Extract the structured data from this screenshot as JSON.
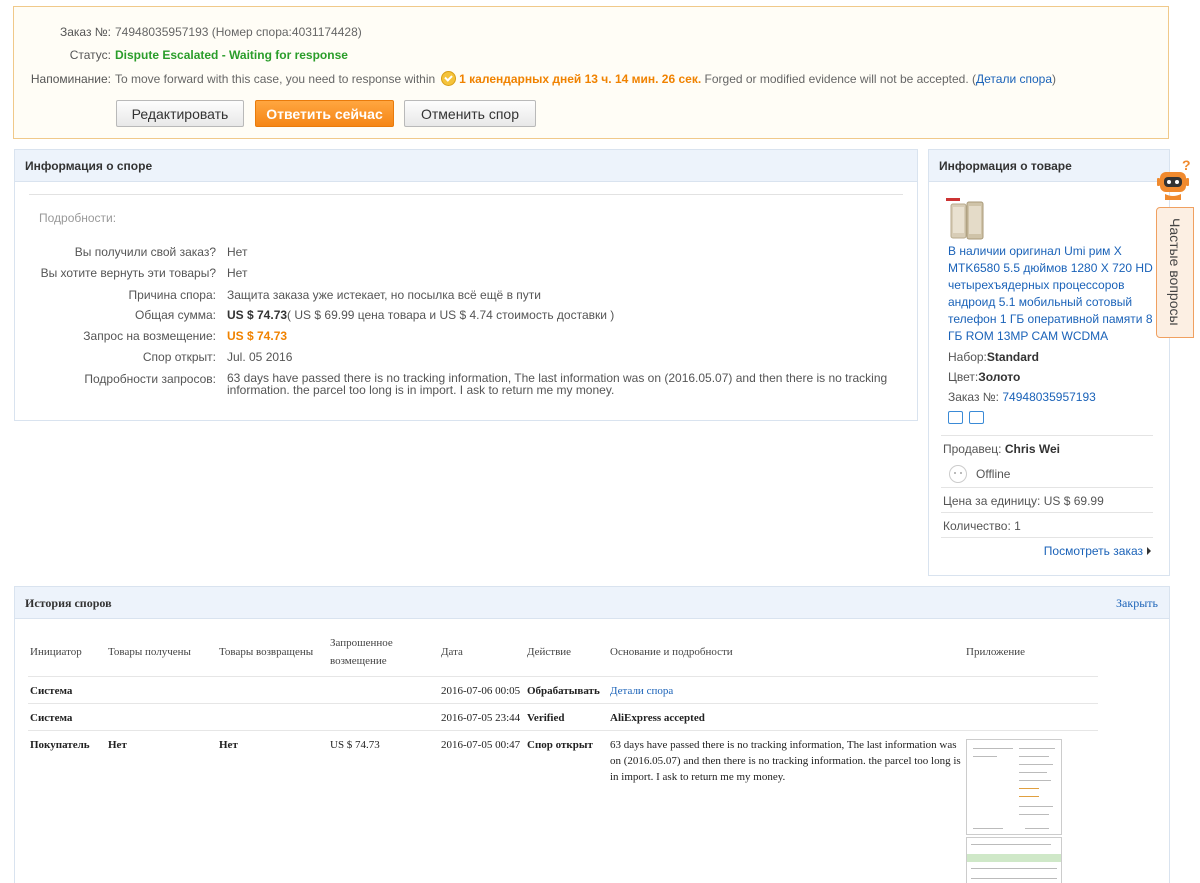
{
  "order": {
    "number_label": "Заказ №:",
    "number_value": "74948035957193 (Номер спора:4031174428)",
    "status_label": "Статус:",
    "status_value": "Dispute Escalated - Waiting for response",
    "reminder_label": "Напоминание:",
    "reminder_text": "To move forward with this case, you need to response within",
    "countdown": "1 календарных дней 13 ч. 14 мин. 26 сек.",
    "reminder_suffix": "Forged or modified evidence will not be accepted.",
    "paren_open": "(",
    "details_link": "Детали спора",
    "paren_close": ")",
    "buttons": {
      "edit": "Редактировать",
      "respond": "Ответить сейчас",
      "cancel": "Отменить спор"
    },
    "colors": {
      "status": "#2a9d2a",
      "countdown": "#f08200",
      "respond_button": "#f58616"
    }
  },
  "dispute": {
    "title": "Информация о споре",
    "details_title": "Подробности:",
    "rows": [
      {
        "label": "Вы получили свой заказ?",
        "value": "Нет"
      },
      {
        "label": "Вы хотите вернуть эти товары?",
        "value": "Нет"
      },
      {
        "label": "Причина спора:",
        "value": "Защита заказа уже истекает, но посылка всё ещё в пути"
      },
      {
        "label": "Общая сумма:",
        "value": "US $ 74.73",
        "extra": "( US $ 69.99 цена товара и US $ 4.74 стоимость доставки )"
      },
      {
        "label": "Запрос на возмещение:",
        "value": "US $ 74.73"
      },
      {
        "label": "Спор открыт:",
        "value": "Jul. 05 2016"
      },
      {
        "label": "Подробности запросов:",
        "value": "63 days have passed there is no tracking information, The last information was on (2016.05.07) and then there is no tracking information. the parcel too long is in import. I ask to return me my money."
      }
    ]
  },
  "product": {
    "title": "Информация о товаре",
    "name": "В наличии оригинал Umi рим X MTK6580 5.5 дюймов 1280 X 720 HD четырехъядерных процессоров андроид 5.1 мобильный сотовый телефон 1 ГБ оперативной памяти 8 ГБ ROM 13MP CAM WCDMA",
    "set_label": "Набор:",
    "set_value": "Standard",
    "color_label": "Цвет:",
    "color_value": "Золото",
    "order_label": "Заказ №:",
    "order_value": "74948035957193",
    "seller_label": "Продавец:",
    "seller_name": "Chris Wei",
    "online_status": "Offline",
    "unit_price_label": "Цена за единицу:",
    "unit_price": "US $ 69.99",
    "quantity_label": "Количество:",
    "quantity": "1",
    "view_order": "Посмотреть заказ"
  },
  "faq": {
    "label": "Частые вопросы",
    "icon": "robot-help-icon"
  },
  "history": {
    "title": "История споров",
    "close": "Закрыть",
    "columns": [
      "Инициатор",
      "Товары получены",
      "Товары возвращены",
      "Запрошенное возмещение",
      "Дата",
      "Действие",
      "Основание и подробности",
      "Приложение"
    ],
    "rows": [
      {
        "initiator": "Система",
        "received": "",
        "returned": "",
        "refund": "",
        "date": "2016-07-06 00:05",
        "action": "Обрабатывать",
        "reason": "Детали спора",
        "reason_is_link": true
      },
      {
        "initiator": "Система",
        "received": "",
        "returned": "",
        "refund": "",
        "date": "2016-07-05 23:44",
        "action": "Verified",
        "reason": "AliExpress accepted"
      },
      {
        "initiator": "Покупатель",
        "received": "Нет",
        "returned": "Нет",
        "refund": "US $ 74.73",
        "date": "2016-07-05 00:47",
        "action": "Спор открыт",
        "reason": "63 days have passed there is no tracking information, The last information was on (2016.05.07) and then there is no tracking information. the parcel too long is in import. I ask to return me my money."
      }
    ]
  }
}
